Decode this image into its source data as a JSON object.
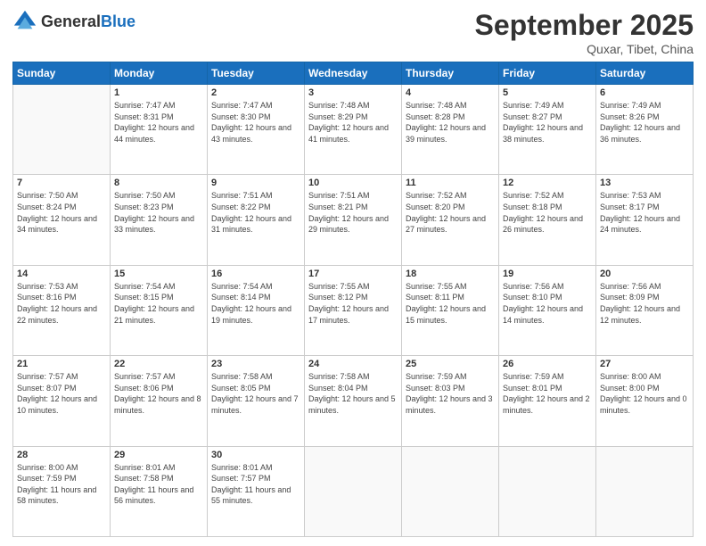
{
  "header": {
    "logo_general": "General",
    "logo_blue": "Blue",
    "month": "September 2025",
    "location": "Quxar, Tibet, China"
  },
  "weekdays": [
    "Sunday",
    "Monday",
    "Tuesday",
    "Wednesday",
    "Thursday",
    "Friday",
    "Saturday"
  ],
  "weeks": [
    [
      {
        "day": "",
        "sunrise": "",
        "sunset": "",
        "daylight": ""
      },
      {
        "day": "1",
        "sunrise": "Sunrise: 7:47 AM",
        "sunset": "Sunset: 8:31 PM",
        "daylight": "Daylight: 12 hours and 44 minutes."
      },
      {
        "day": "2",
        "sunrise": "Sunrise: 7:47 AM",
        "sunset": "Sunset: 8:30 PM",
        "daylight": "Daylight: 12 hours and 43 minutes."
      },
      {
        "day": "3",
        "sunrise": "Sunrise: 7:48 AM",
        "sunset": "Sunset: 8:29 PM",
        "daylight": "Daylight: 12 hours and 41 minutes."
      },
      {
        "day": "4",
        "sunrise": "Sunrise: 7:48 AM",
        "sunset": "Sunset: 8:28 PM",
        "daylight": "Daylight: 12 hours and 39 minutes."
      },
      {
        "day": "5",
        "sunrise": "Sunrise: 7:49 AM",
        "sunset": "Sunset: 8:27 PM",
        "daylight": "Daylight: 12 hours and 38 minutes."
      },
      {
        "day": "6",
        "sunrise": "Sunrise: 7:49 AM",
        "sunset": "Sunset: 8:26 PM",
        "daylight": "Daylight: 12 hours and 36 minutes."
      }
    ],
    [
      {
        "day": "7",
        "sunrise": "Sunrise: 7:50 AM",
        "sunset": "Sunset: 8:24 PM",
        "daylight": "Daylight: 12 hours and 34 minutes."
      },
      {
        "day": "8",
        "sunrise": "Sunrise: 7:50 AM",
        "sunset": "Sunset: 8:23 PM",
        "daylight": "Daylight: 12 hours and 33 minutes."
      },
      {
        "day": "9",
        "sunrise": "Sunrise: 7:51 AM",
        "sunset": "Sunset: 8:22 PM",
        "daylight": "Daylight: 12 hours and 31 minutes."
      },
      {
        "day": "10",
        "sunrise": "Sunrise: 7:51 AM",
        "sunset": "Sunset: 8:21 PM",
        "daylight": "Daylight: 12 hours and 29 minutes."
      },
      {
        "day": "11",
        "sunrise": "Sunrise: 7:52 AM",
        "sunset": "Sunset: 8:20 PM",
        "daylight": "Daylight: 12 hours and 27 minutes."
      },
      {
        "day": "12",
        "sunrise": "Sunrise: 7:52 AM",
        "sunset": "Sunset: 8:18 PM",
        "daylight": "Daylight: 12 hours and 26 minutes."
      },
      {
        "day": "13",
        "sunrise": "Sunrise: 7:53 AM",
        "sunset": "Sunset: 8:17 PM",
        "daylight": "Daylight: 12 hours and 24 minutes."
      }
    ],
    [
      {
        "day": "14",
        "sunrise": "Sunrise: 7:53 AM",
        "sunset": "Sunset: 8:16 PM",
        "daylight": "Daylight: 12 hours and 22 minutes."
      },
      {
        "day": "15",
        "sunrise": "Sunrise: 7:54 AM",
        "sunset": "Sunset: 8:15 PM",
        "daylight": "Daylight: 12 hours and 21 minutes."
      },
      {
        "day": "16",
        "sunrise": "Sunrise: 7:54 AM",
        "sunset": "Sunset: 8:14 PM",
        "daylight": "Daylight: 12 hours and 19 minutes."
      },
      {
        "day": "17",
        "sunrise": "Sunrise: 7:55 AM",
        "sunset": "Sunset: 8:12 PM",
        "daylight": "Daylight: 12 hours and 17 minutes."
      },
      {
        "day": "18",
        "sunrise": "Sunrise: 7:55 AM",
        "sunset": "Sunset: 8:11 PM",
        "daylight": "Daylight: 12 hours and 15 minutes."
      },
      {
        "day": "19",
        "sunrise": "Sunrise: 7:56 AM",
        "sunset": "Sunset: 8:10 PM",
        "daylight": "Daylight: 12 hours and 14 minutes."
      },
      {
        "day": "20",
        "sunrise": "Sunrise: 7:56 AM",
        "sunset": "Sunset: 8:09 PM",
        "daylight": "Daylight: 12 hours and 12 minutes."
      }
    ],
    [
      {
        "day": "21",
        "sunrise": "Sunrise: 7:57 AM",
        "sunset": "Sunset: 8:07 PM",
        "daylight": "Daylight: 12 hours and 10 minutes."
      },
      {
        "day": "22",
        "sunrise": "Sunrise: 7:57 AM",
        "sunset": "Sunset: 8:06 PM",
        "daylight": "Daylight: 12 hours and 8 minutes."
      },
      {
        "day": "23",
        "sunrise": "Sunrise: 7:58 AM",
        "sunset": "Sunset: 8:05 PM",
        "daylight": "Daylight: 12 hours and 7 minutes."
      },
      {
        "day": "24",
        "sunrise": "Sunrise: 7:58 AM",
        "sunset": "Sunset: 8:04 PM",
        "daylight": "Daylight: 12 hours and 5 minutes."
      },
      {
        "day": "25",
        "sunrise": "Sunrise: 7:59 AM",
        "sunset": "Sunset: 8:03 PM",
        "daylight": "Daylight: 12 hours and 3 minutes."
      },
      {
        "day": "26",
        "sunrise": "Sunrise: 7:59 AM",
        "sunset": "Sunset: 8:01 PM",
        "daylight": "Daylight: 12 hours and 2 minutes."
      },
      {
        "day": "27",
        "sunrise": "Sunrise: 8:00 AM",
        "sunset": "Sunset: 8:00 PM",
        "daylight": "Daylight: 12 hours and 0 minutes."
      }
    ],
    [
      {
        "day": "28",
        "sunrise": "Sunrise: 8:00 AM",
        "sunset": "Sunset: 7:59 PM",
        "daylight": "Daylight: 11 hours and 58 minutes."
      },
      {
        "day": "29",
        "sunrise": "Sunrise: 8:01 AM",
        "sunset": "Sunset: 7:58 PM",
        "daylight": "Daylight: 11 hours and 56 minutes."
      },
      {
        "day": "30",
        "sunrise": "Sunrise: 8:01 AM",
        "sunset": "Sunset: 7:57 PM",
        "daylight": "Daylight: 11 hours and 55 minutes."
      },
      {
        "day": "",
        "sunrise": "",
        "sunset": "",
        "daylight": ""
      },
      {
        "day": "",
        "sunrise": "",
        "sunset": "",
        "daylight": ""
      },
      {
        "day": "",
        "sunrise": "",
        "sunset": "",
        "daylight": ""
      },
      {
        "day": "",
        "sunrise": "",
        "sunset": "",
        "daylight": ""
      }
    ]
  ]
}
